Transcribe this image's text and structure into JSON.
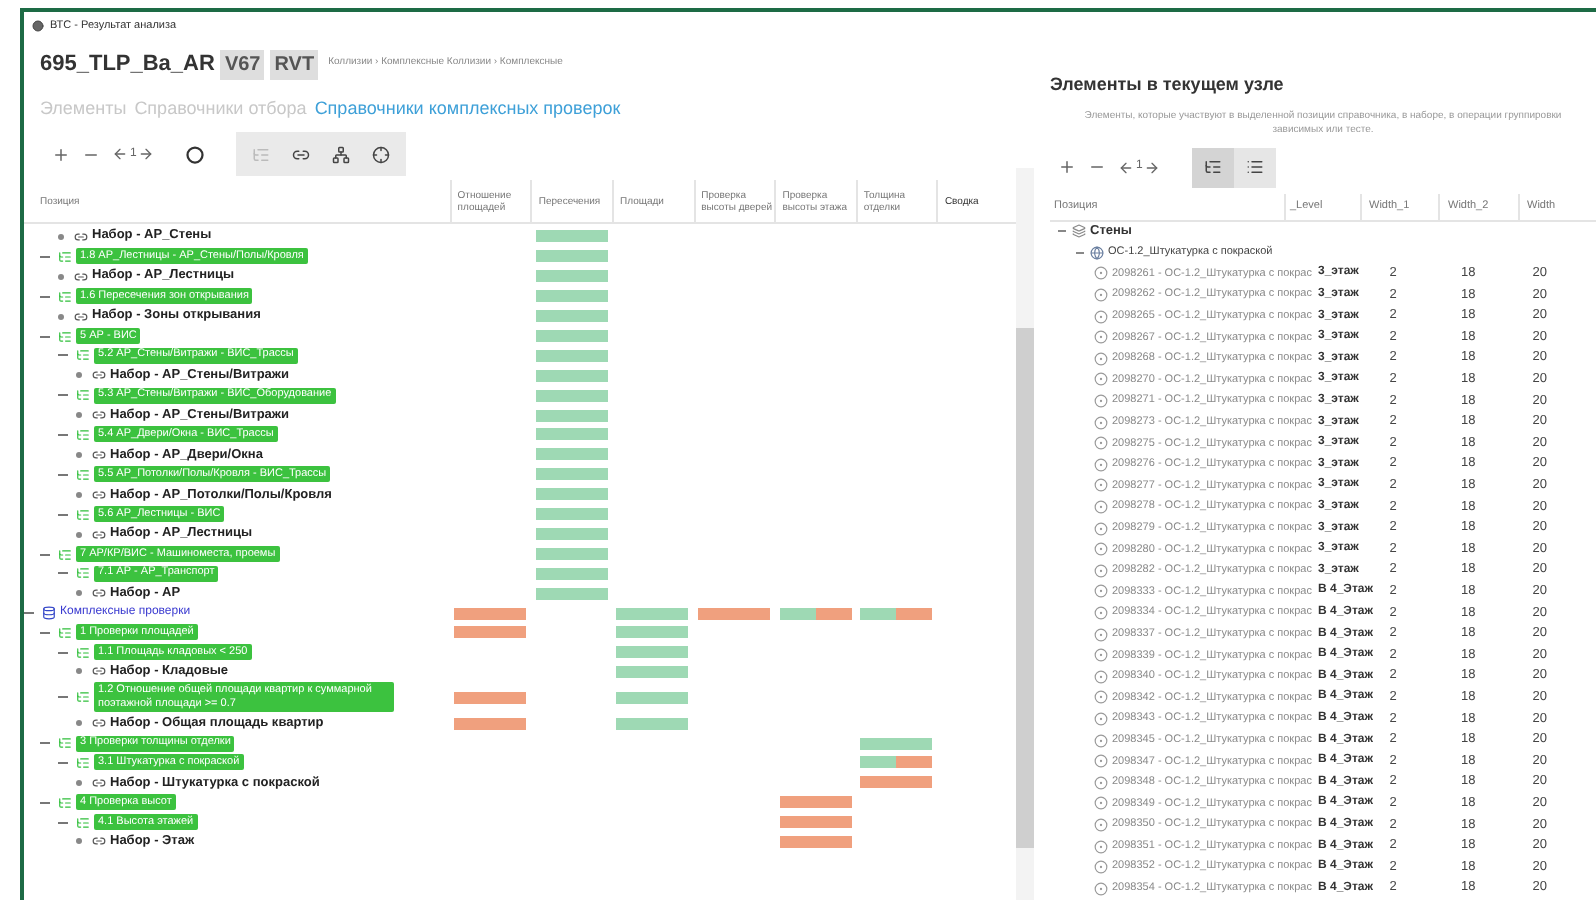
{
  "window": {
    "title": "ВТС - Результат анализа"
  },
  "header": {
    "project": "695_TLP_Ba_AR",
    "badges": [
      "V67",
      "RVT"
    ],
    "breadcrumb": "Коллизии › Комплексные Коллизии › Комплексные"
  },
  "tabs": [
    {
      "label": "Элементы",
      "selected": false
    },
    {
      "label": "Справочники отбора",
      "selected": false
    },
    {
      "label": "Справочники комплексных проверок",
      "selected": true
    }
  ],
  "toolbar": {
    "counter": "1"
  },
  "table": {
    "columns": [
      "Позиция",
      "Отношение площадей",
      "Пересечения",
      "Площади",
      "Проверка высоты дверей",
      "Проверка высоты этажа",
      "Толщина отделки",
      "Сводка"
    ]
  },
  "tree": [
    {
      "kind": "continued",
      "children": [
        {
          "kind": "continued",
          "children": [
            {
              "kind": "set",
              "label": "Набор - АР_Стены",
              "cells": [
                {
                  "kind": "empty"
                },
                {
                  "kind": "pass"
                },
                {
                  "kind": "empty"
                },
                {
                  "kind": "empty"
                },
                {
                  "kind": "empty"
                },
                {
                  "kind": "empty"
                },
                {
                  "kind": "empty"
                }
              ]
            }
          ]
        },
        {
          "kind": "check",
          "label": "1.8 АР_Лестницы - АР_Стены/Полы/Кровля",
          "expanded": true,
          "cells": [
            {
              "kind": "empty"
            },
            {
              "kind": "pass"
            },
            {
              "kind": "empty"
            },
            {
              "kind": "empty"
            },
            {
              "kind": "empty"
            },
            {
              "kind": "empty"
            },
            {
              "kind": "empty"
            }
          ],
          "children": [
            {
              "kind": "set",
              "label": "Набор - АР_Лестницы",
              "cells": [
                {
                  "kind": "empty"
                },
                {
                  "kind": "pass"
                },
                {
                  "kind": "empty"
                },
                {
                  "kind": "empty"
                },
                {
                  "kind": "empty"
                },
                {
                  "kind": "empty"
                },
                {
                  "kind": "empty"
                }
              ]
            }
          ]
        },
        {
          "kind": "check",
          "label": "1.6 Пересечения зон открывания",
          "expanded": true,
          "cells": [
            {
              "kind": "empty"
            },
            {
              "kind": "pass"
            },
            {
              "kind": "empty"
            },
            {
              "kind": "empty"
            },
            {
              "kind": "empty"
            },
            {
              "kind": "empty"
            },
            {
              "kind": "empty"
            }
          ],
          "children": [
            {
              "kind": "set",
              "label": "Набор - Зоны открывания",
              "cells": [
                {
                  "kind": "empty"
                },
                {
                  "kind": "pass"
                },
                {
                  "kind": "empty"
                },
                {
                  "kind": "empty"
                },
                {
                  "kind": "empty"
                },
                {
                  "kind": "empty"
                },
                {
                  "kind": "empty"
                }
              ]
            }
          ]
        }
      ]
    },
    {
      "kind": "continued",
      "children": [
        {
          "kind": "check",
          "label": "5 АР - ВИС",
          "expanded": true,
          "cells": [
            {
              "kind": "empty"
            },
            {
              "kind": "pass"
            },
            {
              "kind": "empty"
            },
            {
              "kind": "empty"
            },
            {
              "kind": "empty"
            },
            {
              "kind": "empty"
            },
            {
              "kind": "empty"
            }
          ],
          "children": [
            {
              "kind": "check",
              "label": "5.2 АР_Стены/Витражи - ВИС_Трассы",
              "expanded": true,
              "cells": [
                {
                  "kind": "empty"
                },
                {
                  "kind": "pass"
                },
                {
                  "kind": "empty"
                },
                {
                  "kind": "empty"
                },
                {
                  "kind": "empty"
                },
                {
                  "kind": "empty"
                },
                {
                  "kind": "empty"
                }
              ],
              "children": [
                {
                  "kind": "set",
                  "label": "Набор - АР_Стены/Витражи",
                  "cells": [
                    {
                      "kind": "empty"
                    },
                    {
                      "kind": "pass"
                    },
                    {
                      "kind": "empty"
                    },
                    {
                      "kind": "empty"
                    },
                    {
                      "kind": "empty"
                    },
                    {
                      "kind": "empty"
                    },
                    {
                      "kind": "empty"
                    }
                  ]
                }
              ]
            },
            {
              "kind": "check",
              "label": "5.3 АР_Стены/Витражи - ВИС_Оборудование",
              "expanded": true,
              "cells": [
                {
                  "kind": "empty"
                },
                {
                  "kind": "pass"
                },
                {
                  "kind": "empty"
                },
                {
                  "kind": "empty"
                },
                {
                  "kind": "empty"
                },
                {
                  "kind": "empty"
                },
                {
                  "kind": "empty"
                }
              ],
              "children": [
                {
                  "kind": "set",
                  "label": "Набор - АР_Стены/Витражи",
                  "cells": [
                    {
                      "kind": "empty"
                    },
                    {
                      "kind": "pass"
                    },
                    {
                      "kind": "empty"
                    },
                    {
                      "kind": "empty"
                    },
                    {
                      "kind": "empty"
                    },
                    {
                      "kind": "empty"
                    },
                    {
                      "kind": "empty"
                    }
                  ]
                }
              ]
            },
            {
              "kind": "check",
              "label": "5.4 АР_Двери/Окна - ВИС_Трассы",
              "expanded": true,
              "cells": [
                {
                  "kind": "empty"
                },
                {
                  "kind": "pass"
                },
                {
                  "kind": "empty"
                },
                {
                  "kind": "empty"
                },
                {
                  "kind": "empty"
                },
                {
                  "kind": "empty"
                },
                {
                  "kind": "empty"
                }
              ],
              "children": [
                {
                  "kind": "set",
                  "label": "Набор - АР_Двери/Окна",
                  "cells": [
                    {
                      "kind": "empty"
                    },
                    {
                      "kind": "pass"
                    },
                    {
                      "kind": "empty"
                    },
                    {
                      "kind": "empty"
                    },
                    {
                      "kind": "empty"
                    },
                    {
                      "kind": "empty"
                    },
                    {
                      "kind": "empty"
                    }
                  ]
                }
              ]
            },
            {
              "kind": "check",
              "label": "5.5 АР_Потолки/Полы/Кровля - ВИС_Трассы",
              "expanded": true,
              "cells": [
                {
                  "kind": "empty"
                },
                {
                  "kind": "pass"
                },
                {
                  "kind": "empty"
                },
                {
                  "kind": "empty"
                },
                {
                  "kind": "empty"
                },
                {
                  "kind": "empty"
                },
                {
                  "kind": "empty"
                }
              ],
              "children": [
                {
                  "kind": "set",
                  "label": "Набор - АР_Потолки/Полы/Кровля",
                  "cells": [
                    {
                      "kind": "empty"
                    },
                    {
                      "kind": "pass"
                    },
                    {
                      "kind": "empty"
                    },
                    {
                      "kind": "empty"
                    },
                    {
                      "kind": "empty"
                    },
                    {
                      "kind": "empty"
                    },
                    {
                      "kind": "empty"
                    }
                  ]
                }
              ]
            },
            {
              "kind": "check",
              "label": "5.6 АР_Лестницы - ВИС",
              "expanded": true,
              "cells": [
                {
                  "kind": "empty"
                },
                {
                  "kind": "pass"
                },
                {
                  "kind": "empty"
                },
                {
                  "kind": "empty"
                },
                {
                  "kind": "empty"
                },
                {
                  "kind": "empty"
                },
                {
                  "kind": "empty"
                }
              ],
              "children": [
                {
                  "kind": "set",
                  "label": "Набор - АР_Лестницы",
                  "cells": [
                    {
                      "kind": "empty"
                    },
                    {
                      "kind": "pass"
                    },
                    {
                      "kind": "empty"
                    },
                    {
                      "kind": "empty"
                    },
                    {
                      "kind": "empty"
                    },
                    {
                      "kind": "empty"
                    },
                    {
                      "kind": "empty"
                    }
                  ]
                }
              ]
            }
          ]
        },
        {
          "kind": "check",
          "label": "7 АР/КР/ВИС - Машиноместа, проемы",
          "expanded": true,
          "cells": [
            {
              "kind": "empty"
            },
            {
              "kind": "pass"
            },
            {
              "kind": "empty"
            },
            {
              "kind": "empty"
            },
            {
              "kind": "empty"
            },
            {
              "kind": "empty"
            },
            {
              "kind": "empty"
            }
          ],
          "children": [
            {
              "kind": "check",
              "label": "7.1 АР - АР_Транспорт",
              "expanded": true,
              "cells": [
                {
                  "kind": "empty"
                },
                {
                  "kind": "pass"
                },
                {
                  "kind": "empty"
                },
                {
                  "kind": "empty"
                },
                {
                  "kind": "empty"
                },
                {
                  "kind": "empty"
                },
                {
                  "kind": "empty"
                }
              ],
              "children": [
                {
                  "kind": "set",
                  "label": "Набор - АР",
                  "cells": [
                    {
                      "kind": "empty"
                    },
                    {
                      "kind": "pass"
                    },
                    {
                      "kind": "empty"
                    },
                    {
                      "kind": "empty"
                    },
                    {
                      "kind": "empty"
                    },
                    {
                      "kind": "empty"
                    },
                    {
                      "kind": "empty"
                    }
                  ]
                }
              ]
            }
          ]
        }
      ]
    },
    {
      "kind": "category",
      "label": "Комплексные проверки",
      "expanded": true,
      "cells": [
        {
          "kind": "fail"
        },
        {
          "kind": "empty"
        },
        {
          "kind": "pass"
        },
        {
          "kind": "fail"
        },
        {
          "kind": "split",
          "level": 0.5
        },
        {
          "kind": "split",
          "level": 0.5
        },
        {
          "kind": "empty"
        }
      ],
      "children": [
        {
          "kind": "check",
          "label": "1 Проверки площадей",
          "expanded": true,
          "cells": [
            {
              "kind": "fail"
            },
            {
              "kind": "empty"
            },
            {
              "kind": "pass"
            },
            {
              "kind": "empty"
            },
            {
              "kind": "empty"
            },
            {
              "kind": "empty"
            },
            {
              "kind": "empty"
            }
          ],
          "children": [
            {
              "kind": "check",
              "label": "1.1 Площадь кладовых < 250",
              "expanded": true,
              "cells": [
                {
                  "kind": "empty"
                },
                {
                  "kind": "empty"
                },
                {
                  "kind": "pass"
                },
                {
                  "kind": "empty"
                },
                {
                  "kind": "empty"
                },
                {
                  "kind": "empty"
                },
                {
                  "kind": "empty"
                }
              ],
              "children": [
                {
                  "kind": "set",
                  "label": "Набор - Кладовые",
                  "cells": [
                    {
                      "kind": "empty"
                    },
                    {
                      "kind": "empty"
                    },
                    {
                      "kind": "pass"
                    },
                    {
                      "kind": "empty"
                    },
                    {
                      "kind": "empty"
                    },
                    {
                      "kind": "empty"
                    },
                    {
                      "kind": "empty"
                    }
                  ]
                }
              ]
            },
            {
              "kind": "check",
              "label": "1.2 Отношение общей площади квартир к суммарной поэтажной площади >= 0.7",
              "expanded": true,
              "cells": [
                {
                  "kind": "fail"
                },
                {
                  "kind": "empty"
                },
                {
                  "kind": "pass"
                },
                {
                  "kind": "empty"
                },
                {
                  "kind": "empty"
                },
                {
                  "kind": "empty"
                },
                {
                  "kind": "empty"
                }
              ],
              "children": [
                {
                  "kind": "set",
                  "label": "Набор - Общая площадь квартир",
                  "cells": [
                    {
                      "kind": "fail"
                    },
                    {
                      "kind": "empty"
                    },
                    {
                      "kind": "pass"
                    },
                    {
                      "kind": "empty"
                    },
                    {
                      "kind": "empty"
                    },
                    {
                      "kind": "empty"
                    },
                    {
                      "kind": "empty"
                    }
                  ]
                }
              ]
            }
          ]
        },
        {
          "kind": "check",
          "label": "3 Проверки толщины отделки",
          "expanded": true,
          "cells": [
            {
              "kind": "empty"
            },
            {
              "kind": "empty"
            },
            {
              "kind": "empty"
            },
            {
              "kind": "empty"
            },
            {
              "kind": "empty"
            },
            {
              "kind": "pass"
            },
            {
              "kind": "empty"
            }
          ],
          "children": [
            {
              "kind": "check",
              "label": "3.1 Штукатурка с покраской",
              "expanded": true,
              "cells": [
                {
                  "kind": "empty"
                },
                {
                  "kind": "empty"
                },
                {
                  "kind": "empty"
                },
                {
                  "kind": "empty"
                },
                {
                  "kind": "empty"
                },
                {
                  "kind": "split",
                  "level": 0.5
                },
                {
                  "kind": "empty"
                }
              ],
              "children": [
                {
                  "kind": "set",
                  "label": "Набор - Штукатурка с покраской",
                  "cells": [
                    {
                      "kind": "empty"
                    },
                    {
                      "kind": "empty"
                    },
                    {
                      "kind": "empty"
                    },
                    {
                      "kind": "empty"
                    },
                    {
                      "kind": "empty"
                    },
                    {
                      "kind": "fail"
                    },
                    {
                      "kind": "empty"
                    }
                  ]
                }
              ]
            }
          ]
        },
        {
          "kind": "check",
          "label": "4 Проверка высот",
          "expanded": true,
          "cells": [
            {
              "kind": "empty"
            },
            {
              "kind": "empty"
            },
            {
              "kind": "empty"
            },
            {
              "kind": "empty"
            },
            {
              "kind": "fail"
            },
            {
              "kind": "empty"
            },
            {
              "kind": "empty"
            }
          ],
          "children": [
            {
              "kind": "check",
              "label": "4.1 Высота этажей",
              "expanded": true,
              "cells": [
                {
                  "kind": "empty"
                },
                {
                  "kind": "empty"
                },
                {
                  "kind": "empty"
                },
                {
                  "kind": "empty"
                },
                {
                  "kind": "fail"
                },
                {
                  "kind": "empty"
                },
                {
                  "kind": "empty"
                }
              ],
              "children": [
                {
                  "kind": "set",
                  "label": "Набор - Этаж",
                  "cells": [
                    {
                      "kind": "empty"
                    },
                    {
                      "kind": "empty"
                    },
                    {
                      "kind": "empty"
                    },
                    {
                      "kind": "empty"
                    },
                    {
                      "kind": "fail"
                    },
                    {
                      "kind": "empty"
                    },
                    {
                      "kind": "empty"
                    }
                  ]
                }
              ]
            }
          ]
        }
      ]
    }
  ],
  "side_panel": {
    "title": "Элементы в текущем узле",
    "description": "Элементы, которые участвуют в выделенной позиции справочника, в наборе, в операции группировки зависимых или тесте.",
    "counter": "1",
    "views": [
      {
        "kind": "tree",
        "selected": true
      },
      {
        "kind": "list",
        "selected": false
      }
    ],
    "columns": [
      "Позиция",
      "_Level",
      "Width_1",
      "Width_2",
      "Width"
    ],
    "tree": [
      {
        "kind": "group",
        "label": "Стены",
        "expanded": true,
        "children": [
          {
            "kind": "type",
            "label": "ОС-1.2_Штукатурка с покраской",
            "expanded": true,
            "children": [
              {
                "kind": "element",
                "label": "2098261 - ОС-1.2_Штукатурка с покрас",
                "cells": [
                  "3_этаж",
                  "2",
                  "18",
                  "20"
                ]
              },
              {
                "kind": "element",
                "label": "2098262 - ОС-1.2_Штукатурка с покрас",
                "cells": [
                  "3_этаж",
                  "2",
                  "18",
                  "20"
                ]
              },
              {
                "kind": "element",
                "label": "2098265 - ОС-1.2_Штукатурка с покрас",
                "cells": [
                  "3_этаж",
                  "2",
                  "18",
                  "20"
                ]
              },
              {
                "kind": "element",
                "label": "2098267 - ОС-1.2_Штукатурка с покрас",
                "cells": [
                  "3_этаж",
                  "2",
                  "18",
                  "20"
                ]
              },
              {
                "kind": "element",
                "label": "2098268 - ОС-1.2_Штукатурка с покрас",
                "cells": [
                  "3_этаж",
                  "2",
                  "18",
                  "20"
                ]
              },
              {
                "kind": "element",
                "label": "2098270 - ОС-1.2_Штукатурка с покрас",
                "cells": [
                  "3_этаж",
                  "2",
                  "18",
                  "20"
                ]
              },
              {
                "kind": "element",
                "label": "2098271 - ОС-1.2_Штукатурка с покрас",
                "cells": [
                  "3_этаж",
                  "2",
                  "18",
                  "20"
                ]
              },
              {
                "kind": "element",
                "label": "2098273 - ОС-1.2_Штукатурка с покрас",
                "cells": [
                  "3_этаж",
                  "2",
                  "18",
                  "20"
                ]
              },
              {
                "kind": "element",
                "label": "2098275 - ОС-1.2_Штукатурка с покрас",
                "cells": [
                  "3_этаж",
                  "2",
                  "18",
                  "20"
                ]
              },
              {
                "kind": "element",
                "label": "2098276 - ОС-1.2_Штукатурка с покрас",
                "cells": [
                  "3_этаж",
                  "2",
                  "18",
                  "20"
                ]
              },
              {
                "kind": "element",
                "label": "2098277 - ОС-1.2_Штукатурка с покрас",
                "cells": [
                  "3_этаж",
                  "2",
                  "18",
                  "20"
                ]
              },
              {
                "kind": "element",
                "label": "2098278 - ОС-1.2_Штукатурка с покрас",
                "cells": [
                  "3_этаж",
                  "2",
                  "18",
                  "20"
                ]
              },
              {
                "kind": "element",
                "label": "2098279 - ОС-1.2_Штукатурка с покрас",
                "cells": [
                  "3_этаж",
                  "2",
                  "18",
                  "20"
                ]
              },
              {
                "kind": "element",
                "label": "2098280 - ОС-1.2_Штукатурка с покрас",
                "cells": [
                  "3_этаж",
                  "2",
                  "18",
                  "20"
                ]
              },
              {
                "kind": "element",
                "label": "2098282 - ОС-1.2_Штукатурка с покрас",
                "cells": [
                  "3_этаж",
                  "2",
                  "18",
                  "20"
                ]
              },
              {
                "kind": "element",
                "label": "2098333 - ОС-1.2_Штукатурка с покрас",
                "cells": [
                  "В 4_Этаж",
                  "2",
                  "18",
                  "20"
                ]
              },
              {
                "kind": "element",
                "label": "2098334 - ОС-1.2_Штукатурка с покрас",
                "cells": [
                  "В 4_Этаж",
                  "2",
                  "18",
                  "20"
                ]
              },
              {
                "kind": "element",
                "label": "2098337 - ОС-1.2_Штукатурка с покрас",
                "cells": [
                  "В 4_Этаж",
                  "2",
                  "18",
                  "20"
                ]
              },
              {
                "kind": "element",
                "label": "2098339 - ОС-1.2_Штукатурка с покрас",
                "cells": [
                  "В 4_Этаж",
                  "2",
                  "18",
                  "20"
                ]
              },
              {
                "kind": "element",
                "label": "2098340 - ОС-1.2_Штукатурка с покрас",
                "cells": [
                  "В 4_Этаж",
                  "2",
                  "18",
                  "20"
                ]
              },
              {
                "kind": "element",
                "label": "2098342 - ОС-1.2_Штукатурка с покрас",
                "cells": [
                  "В 4_Этаж",
                  "2",
                  "18",
                  "20"
                ]
              },
              {
                "kind": "element",
                "label": "2098343 - ОС-1.2_Штукатурка с покрас",
                "cells": [
                  "В 4_Этаж",
                  "2",
                  "18",
                  "20"
                ]
              },
              {
                "kind": "element",
                "label": "2098345 - ОС-1.2_Штукатурка с покрас",
                "cells": [
                  "В 4_Этаж",
                  "2",
                  "18",
                  "20"
                ]
              },
              {
                "kind": "element",
                "label": "2098347 - ОС-1.2_Штукатурка с покрас",
                "cells": [
                  "В 4_Этаж",
                  "2",
                  "18",
                  "20"
                ]
              },
              {
                "kind": "element",
                "label": "2098348 - ОС-1.2_Штукатурка с покрас",
                "cells": [
                  "В 4_Этаж",
                  "2",
                  "18",
                  "20"
                ]
              },
              {
                "kind": "element",
                "label": "2098349 - ОС-1.2_Штукатурка с покрас",
                "cells": [
                  "В 4_Этаж",
                  "2",
                  "18",
                  "20"
                ]
              },
              {
                "kind": "element",
                "label": "2098350 - ОС-1.2_Штукатурка с покрас",
                "cells": [
                  "В 4_Этаж",
                  "2",
                  "18",
                  "20"
                ]
              },
              {
                "kind": "element",
                "label": "2098351 - ОС-1.2_Штукатурка с покрас",
                "cells": [
                  "В 4_Этаж",
                  "2",
                  "18",
                  "20"
                ]
              },
              {
                "kind": "element",
                "label": "2098352 - ОС-1.2_Штукатурка с покрас",
                "cells": [
                  "В 4_Этаж",
                  "2",
                  "18",
                  "20"
                ]
              },
              {
                "kind": "element",
                "label": "2098354 - ОС-1.2_Штукатурка с покрас",
                "cells": [
                  "В 4_Этаж",
                  "2",
                  "18",
                  "20"
                ]
              }
            ]
          }
        ]
      }
    ]
  }
}
